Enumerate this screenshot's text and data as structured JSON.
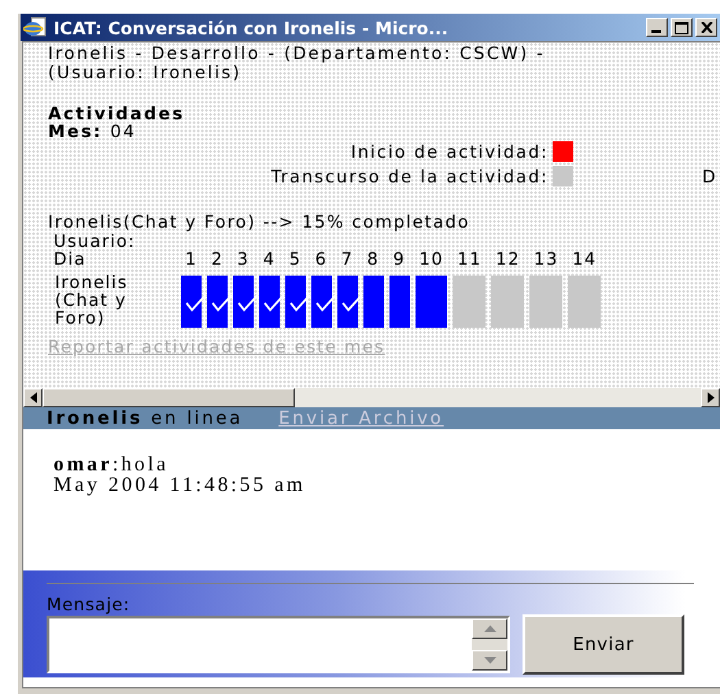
{
  "window": {
    "title": "ICAT: Conversación con Ironelis - Micro..."
  },
  "header": {
    "user_line": "Ironelis - Desarrollo - (Departamento: CSCW) - (Usuario: Ironelis)",
    "section_title": "Actividades",
    "month": "**Mes:** 04"
  },
  "legend": [
    {
      "label": "Inicio de actividad:",
      "color": "#ff0000"
    },
    {
      "label": "Transcurso de la actividad:",
      "color": "#c8c8c8"
    }
  ],
  "legend_cut_text": "D",
  "progress": {
    "title": "Ironelis(Chat y Foro) --> 15% completado",
    "corner_label": "Usuario: Dia",
    "row_label": "Ironelis (Chat y Foro)",
    "days": [
      {
        "label": "1",
        "color": "#0000ff",
        "checked": true
      },
      {
        "label": "2",
        "color": "#0000ff",
        "checked": true
      },
      {
        "label": "3",
        "color": "#0000ff",
        "checked": true
      },
      {
        "label": "4",
        "color": "#0000ff",
        "checked": true
      },
      {
        "label": "5",
        "color": "#0000ff",
        "checked": true
      },
      {
        "label": "6",
        "color": "#0000ff",
        "checked": true
      },
      {
        "label": "7",
        "color": "#0000ff",
        "checked": true
      },
      {
        "label": "8",
        "color": "#0000ff",
        "checked": false
      },
      {
        "label": "9",
        "color": "#0000ff",
        "checked": false
      },
      {
        "label": "10",
        "color": "#0000ff",
        "checked": false
      },
      {
        "label": "11",
        "color": "#c8c8c8",
        "checked": false
      },
      {
        "label": "12",
        "color": "#c8c8c8",
        "checked": false
      },
      {
        "label": "13",
        "color": "#c8c8c8",
        "checked": false
      },
      {
        "label": "14",
        "color": "#c8c8c8",
        "checked": false
      }
    ]
  },
  "report_link": {
    "label": "Reportar actividades de este mes",
    "disabled": true
  },
  "status_bar": {
    "presence": "**Ironelis** en linea",
    "link": "Enviar Archivo"
  },
  "messages": [
    {
      "line": "**omar**:hola",
      "timestamp": "May 2004 11:48:55 am"
    }
  ],
  "compose": {
    "label": "Mensaje:",
    "send_button": "Enviar"
  }
}
